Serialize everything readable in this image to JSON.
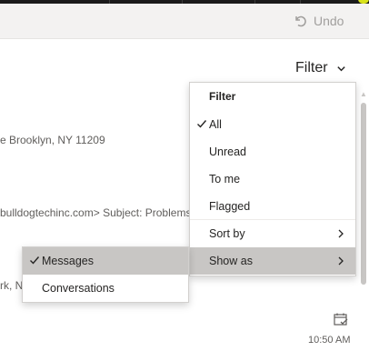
{
  "toolbar": {
    "undo_label": "Undo"
  },
  "filter_button": {
    "label": "Filter"
  },
  "background_snippets": {
    "address": "e Brooklyn, NY 11209",
    "email_line": "bulldogtechinc.com> Subject: Problems *",
    "partial": "rk, N"
  },
  "message": {
    "time": "10:50 AM"
  },
  "filter_menu": {
    "heading": "Filter",
    "items": [
      {
        "label": "All",
        "checked": true
      },
      {
        "label": "Unread",
        "checked": false
      },
      {
        "label": "To me",
        "checked": false
      },
      {
        "label": "Flagged",
        "checked": false
      }
    ],
    "sort_by": "Sort by",
    "show_as": "Show as"
  },
  "show_as_submenu": {
    "items": [
      {
        "label": "Messages",
        "checked": true
      },
      {
        "label": "Conversations",
        "checked": false
      }
    ]
  },
  "colors": {
    "hover": "#c8c6c4",
    "command_bar": "#f3f2f1",
    "top_bar": "#1b1b1b"
  }
}
